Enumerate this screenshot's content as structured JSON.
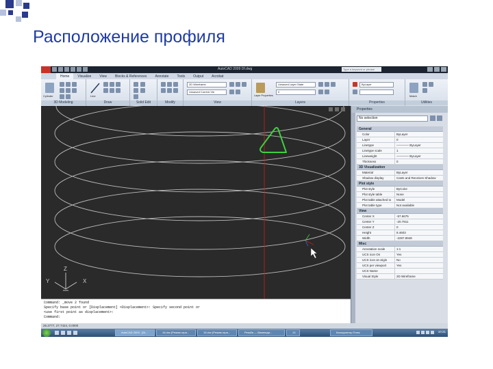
{
  "slide": {
    "title": "Расположение профиля",
    "colors": {
      "title": "#1f3ba6",
      "square_blue": "#2a3a8c",
      "square_light": "#b7c1de"
    }
  },
  "app": {
    "window_title": "AutoCAD 2009 Df.dwg",
    "help_search_placeholder": "Type a keyword or phrase",
    "ribbon_tabs": [
      "Home",
      "Visualize",
      "View",
      "Blocks & References",
      "Annotate",
      "Tools",
      "Output",
      "Acrobat"
    ],
    "active_tab": "Home",
    "panels": [
      {
        "label": "3D Modeling",
        "button": "Cylinder"
      },
      {
        "label": "Draw",
        "button": "Line"
      },
      {
        "label": "Solid Edit",
        "button": ""
      },
      {
        "label": "Modify",
        "button": ""
      },
      {
        "label": "View",
        "combo1": "2D Wireframe",
        "combo2": "Unsaved Current Vie"
      },
      {
        "label": "Layers",
        "button": "Layer Properties",
        "combo1": "Unsaved Layer State",
        "combo2": "0"
      },
      {
        "label": "Properties",
        "combo1": "ByLayer"
      },
      {
        "label": "Utilities",
        "button": "Match"
      }
    ]
  },
  "viewport": {
    "colors": {
      "background": "#2a2a2a",
      "rings": "#bdbdbd",
      "profile": "#3ed13e",
      "axis": "#c21f1f"
    },
    "ucs": {
      "x": "X",
      "y": "Y",
      "z": "Z"
    }
  },
  "command_line": {
    "lines": [
      "Command: _move 2 found",
      "Specify base point or [Displacement] <Displacement>: Specify second point or",
      "<use first point as displacement>:",
      "Command:"
    ]
  },
  "properties": {
    "title": "Properties",
    "selection": "No selection",
    "categories": [
      {
        "name": "General",
        "rows": [
          [
            "Color",
            "ByLayer"
          ],
          [
            "Layer",
            "0"
          ],
          [
            "Linetype",
            "———— ByLayer"
          ],
          [
            "Linetype scale",
            "1"
          ],
          [
            "Lineweight",
            "———— ByLayer"
          ],
          [
            "Thickness",
            "0"
          ]
        ]
      },
      {
        "name": "3D Visualization",
        "rows": [
          [
            "Material",
            "ByLayer"
          ],
          [
            "Shadow display",
            "Casts and Receives Shadow"
          ]
        ]
      },
      {
        "name": "Plot style",
        "rows": [
          [
            "Plot style",
            "ByColor"
          ],
          [
            "Plot style table",
            "None"
          ],
          [
            "Plot table attached to",
            "Model"
          ],
          [
            "Plot table type",
            "Not available"
          ]
        ]
      },
      {
        "name": "View",
        "rows": [
          [
            "Center X",
            "-57.6675"
          ],
          [
            "Center Y",
            "-20.7911"
          ],
          [
            "Center Z",
            "0"
          ],
          [
            "Height",
            "8.4603"
          ],
          [
            "Width",
            "-2287.8948"
          ]
        ]
      },
      {
        "name": "Misc",
        "rows": [
          [
            "Annotation scale",
            "1:1"
          ],
          [
            "UCS icon On",
            "Yes"
          ],
          [
            "UCS icon at origin",
            "No"
          ],
          [
            "UCS per viewport",
            "Yes"
          ],
          [
            "UCS Name",
            ""
          ],
          [
            "Visual Style",
            "2D Wireframe"
          ]
        ]
      }
    ]
  },
  "statusbar": {
    "text": "26.3777, 27.7424, 0.0000",
    "taskbar_items": [
      "AutoCAD 2009 - [Di...",
      "16.doc [Режим огра...",
      "15.doc [Режим огра...",
      "Резьба — Википеди...",
      "13",
      "Калькулятор Плюс"
    ],
    "clock": "10:21"
  }
}
